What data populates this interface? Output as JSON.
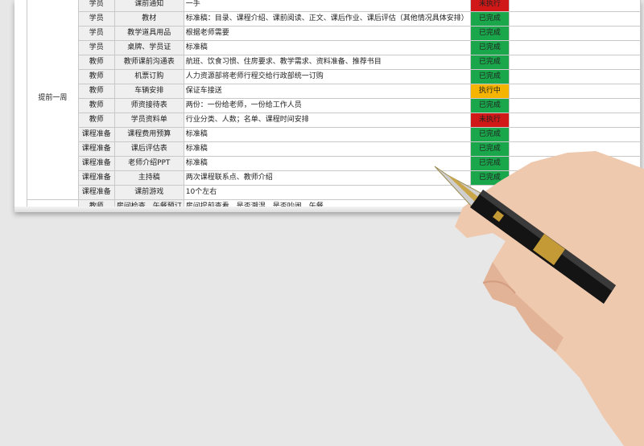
{
  "colors": {
    "done": "#1aa64b",
    "in_progress": "#f5b400",
    "not_done": "#d01818"
  },
  "group_label": "提前一周",
  "rows": [
    {
      "role": "学员",
      "item": "课前通知",
      "desc": "一手",
      "status": "未执行",
      "state": "not_done"
    },
    {
      "role": "学员",
      "item": "教材",
      "desc": "标准稿：目录、课程介绍、课前阅读、正文、课后作业、课后评估（其他情况具体安排）",
      "status": "已完成",
      "state": "done"
    },
    {
      "role": "学员",
      "item": "教学道具用品",
      "desc": "根据老师需要",
      "status": "已完成",
      "state": "done"
    },
    {
      "role": "学员",
      "item": "桌牌、学员证",
      "desc": "标准稿",
      "status": "已完成",
      "state": "done"
    },
    {
      "role": "教师",
      "item": "教师课前沟通表",
      "desc": "航班、饮食习惯、住房要求、教学需求、资料准备、推荐书目",
      "status": "已完成",
      "state": "done"
    },
    {
      "role": "教师",
      "item": "机票订购",
      "desc": "人力资源部将老师行程交给行政部统一订购",
      "status": "已完成",
      "state": "done"
    },
    {
      "role": "教师",
      "item": "车辆安排",
      "desc": "保证车接送",
      "status": "执行中",
      "state": "in_progress"
    },
    {
      "role": "教师",
      "item": "师资接待表",
      "desc": "两份：一份给老师，一份给工作人员",
      "status": "已完成",
      "state": "done"
    },
    {
      "role": "教师",
      "item": "学员资料单",
      "desc": "行业分类、人数；名单、课程时间安排",
      "status": "未执行",
      "state": "not_done"
    },
    {
      "role": "课程准备",
      "item": "课程费用预算",
      "desc": "标准稿",
      "status": "已完成",
      "state": "done"
    },
    {
      "role": "课程准备",
      "item": "课后评估表",
      "desc": "标准稿",
      "status": "已完成",
      "state": "done"
    },
    {
      "role": "课程准备",
      "item": "老师介绍PPT",
      "desc": "标准稿",
      "status": "已完成",
      "state": "done"
    },
    {
      "role": "课程准备",
      "item": "主持稿",
      "desc": "两次课程联系点、教师介绍",
      "status": "已完成",
      "state": "done"
    },
    {
      "role": "课程准备",
      "item": "课前游戏",
      "desc": "10个左右",
      "status": "",
      "state": "blank"
    },
    {
      "role": "教师",
      "item": "房间检查、午餐预订",
      "desc": "房间提前查看，是否潮湿，是否吵闹，午餐",
      "status": "",
      "state": "blank"
    }
  ]
}
